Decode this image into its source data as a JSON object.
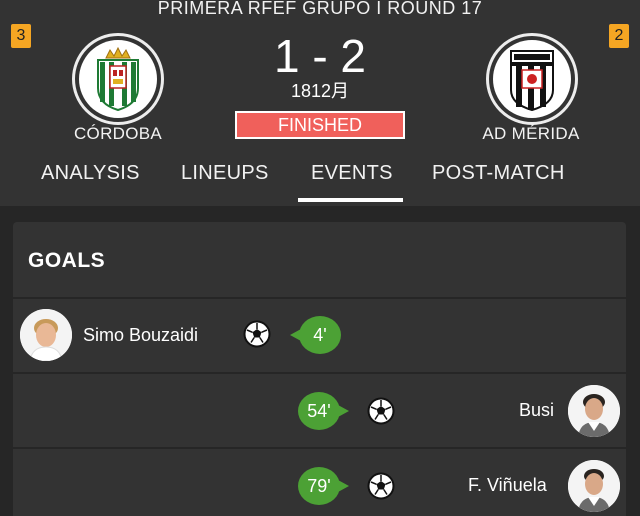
{
  "match": {
    "competition": "PRIMERA RFEF  GRUPO I ROUND 17",
    "home": {
      "name": "CÓRDOBA",
      "rank": "3"
    },
    "away": {
      "name": "AD MÉRIDA",
      "rank": "2"
    },
    "score": "1 - 2",
    "date": "1812月",
    "status": "FINISHED",
    "status_color": "#f0605b"
  },
  "tabs": [
    {
      "label": "ANALYSIS"
    },
    {
      "label": "LINEUPS"
    },
    {
      "label": "EVENTS",
      "active": true
    },
    {
      "label": "POST-MATCH"
    }
  ],
  "goals": {
    "title": "GOALS",
    "events": [
      {
        "side": "home",
        "player": "Simo Bouzaidi",
        "minute": "4'",
        "icon": "soccer-ball-icon"
      },
      {
        "side": "away",
        "player": "Busi",
        "minute": "54'",
        "icon": "soccer-ball-icon"
      },
      {
        "side": "away",
        "player": "F. Viñuela",
        "minute": "79'",
        "icon": "soccer-ball-icon"
      }
    ]
  },
  "colors": {
    "background": "#262626",
    "panel": "#333333",
    "minute_badge": "#4ca135",
    "rank_badge": "#f5a623"
  }
}
